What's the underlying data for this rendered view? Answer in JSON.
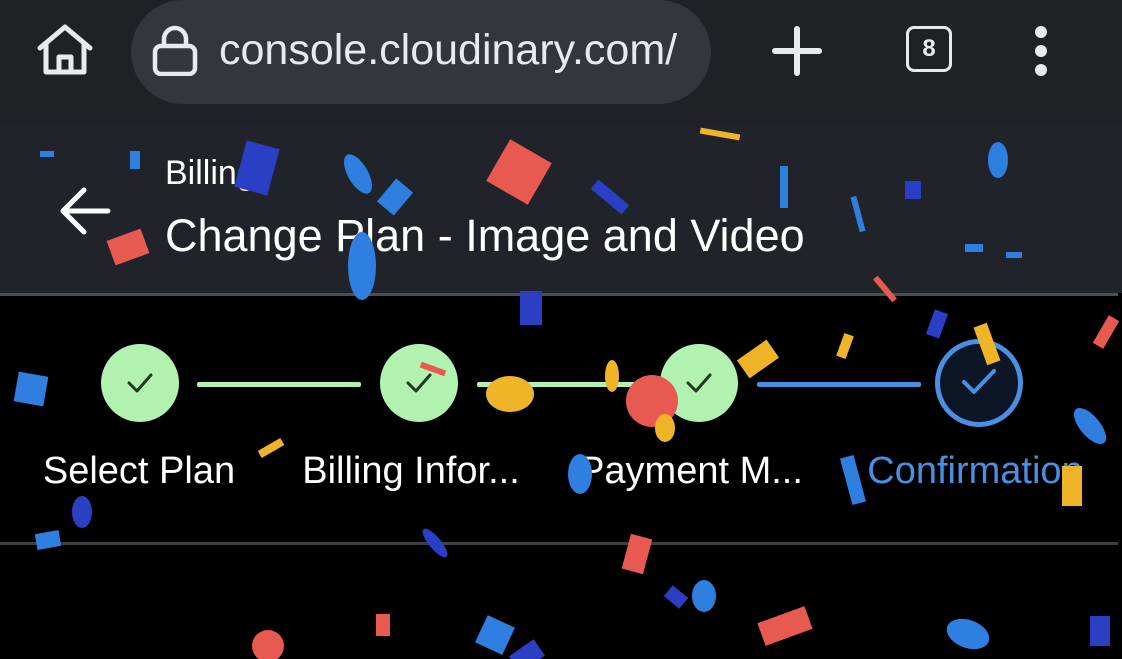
{
  "browser": {
    "url": "console.cloudinary.com/",
    "tab_count": "8",
    "icons": [
      "home-icon",
      "lock-icon",
      "plus-icon",
      "tab-switcher-icon",
      "more-vertical-icon"
    ]
  },
  "header": {
    "breadcrumb": "Billing",
    "title": "Change Plan - Image and Video"
  },
  "stepper": {
    "steps": [
      {
        "label": "Select Plan",
        "status": "completed"
      },
      {
        "label": "Billing Infor...",
        "status": "completed"
      },
      {
        "label": "Payment M...",
        "status": "completed"
      },
      {
        "label": "Confirmation",
        "status": "current"
      }
    ]
  },
  "colors": {
    "completed": "#b2f2b0",
    "active": "#4a90e2",
    "header_bg": "#20232a",
    "page_bg": "#000000"
  }
}
